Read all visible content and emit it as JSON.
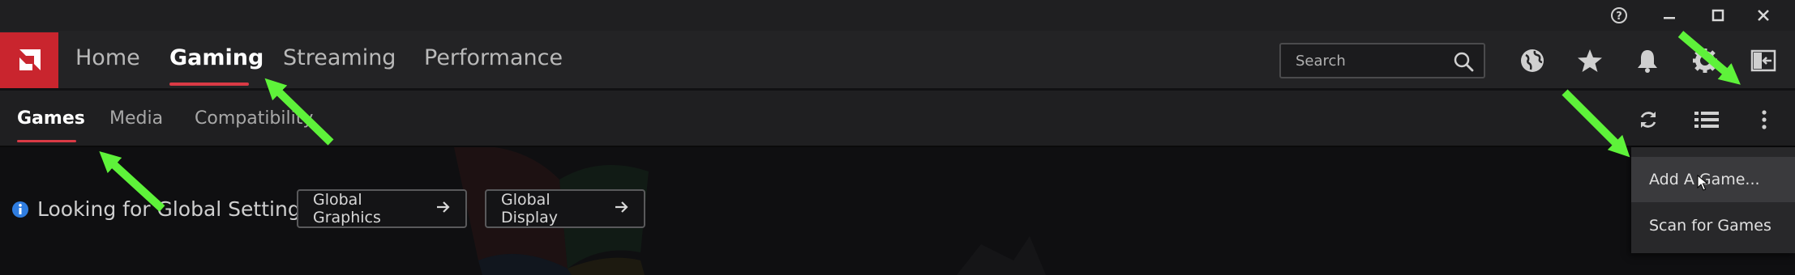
{
  "window_controls": {
    "help": "help-icon",
    "minimize": "minimize-icon",
    "maximize": "maximize-icon",
    "close": "close-icon"
  },
  "brand": {
    "logo": "amd-logo",
    "accent": "#c9252e",
    "underline": "#d93a45"
  },
  "top_nav": {
    "home": "Home",
    "gaming": "Gaming",
    "streaming": "Streaming",
    "performance": "Performance"
  },
  "search": {
    "placeholder": "Search"
  },
  "top_icons": [
    "globe-icon",
    "star-icon",
    "bell-icon",
    "gear-icon",
    "sidebar-toggle-icon"
  ],
  "sub_nav": {
    "games": "Games",
    "media": "Media",
    "compatibility": "Compatibility"
  },
  "sub_icons": [
    "refresh-icon",
    "list-view-icon",
    "more-options-icon"
  ],
  "global_settings": {
    "prompt": "Looking for Global Settings?",
    "graphics_button": "Global Graphics",
    "display_button": "Global Display"
  },
  "dropdown": {
    "add_game": "Add A Game...",
    "scan_games": "Scan for Games"
  },
  "annotation_color": "#5ef23a"
}
